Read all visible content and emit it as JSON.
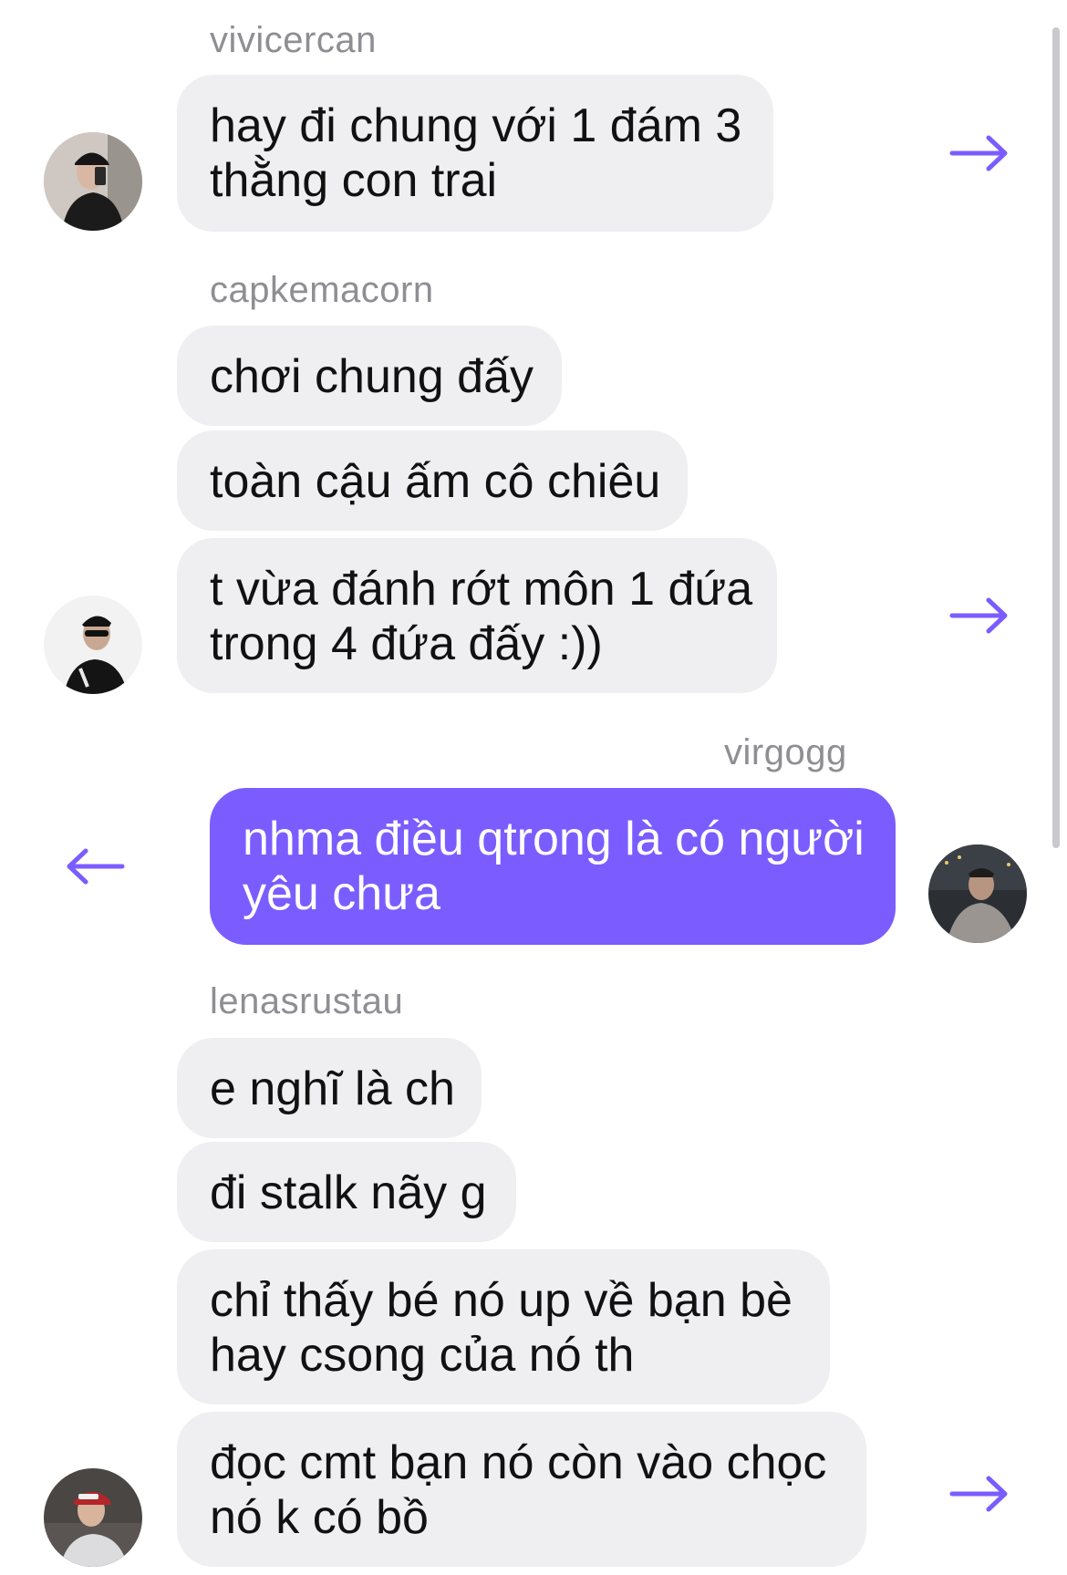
{
  "accent_color": "#7b5cff",
  "bubble_color": "#efeff2",
  "groups": [
    {
      "sender": "vivicercan",
      "messages": [
        "hay đi chung với 1 đám 3",
        "thằng con trai"
      ],
      "avatar_icon": "user-avatar-woman-cap"
    },
    {
      "sender": "capkemacorn",
      "messages": [
        "chơi chung đấy",
        "toàn cậu ấm cô chiêu",
        "t vừa đánh rớt môn 1 đứa",
        "trong 4 đứa đấy :))"
      ],
      "avatar_icon": "user-avatar-man-sunglasses"
    },
    {
      "sender": "virgogg",
      "messages": [
        "nhma điều qtrong là có người",
        "yêu chưa"
      ],
      "avatar_icon": "user-avatar-man-city"
    },
    {
      "sender": "lenasrustau",
      "messages": [
        "e nghĩ là ch",
        "đi stalk nãy g",
        "chỉ thấy bé nó up về bạn bè",
        "hay csong của nó th",
        "đọc cmt bạn nó còn vào chọc",
        "nó k có bồ"
      ],
      "avatar_icon": "user-avatar-girl-red-cap"
    }
  ]
}
